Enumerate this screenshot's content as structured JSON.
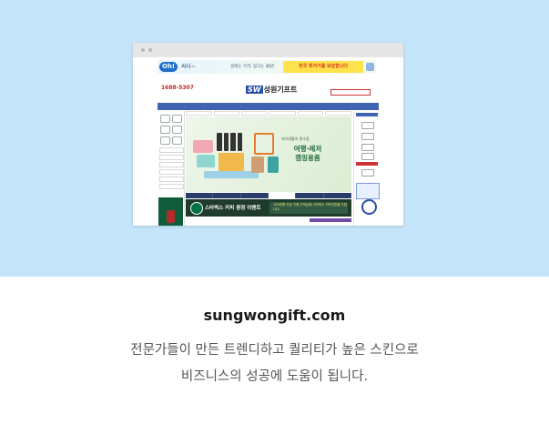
{
  "site_url": "sungwongift.com",
  "description_lines": [
    "전문가들이 만든 트렌디하고 퀄리티가 높은 스킨으로",
    "비즈니스의 성공에 도움이 됩니다."
  ],
  "preview": {
    "top_banner": {
      "badge": "Oh!",
      "headline": "싸다~",
      "middle": "설레는 가격, 믿고는 몰랄!",
      "right": "전국 최저가를 보장합니다"
    },
    "header": {
      "phone": "1688-5307",
      "logo_mark": "SW",
      "logo_text": "성원기프트"
    },
    "nav_items": [
      "",
      "",
      "",
      "",
      "",
      "",
      "",
      "",
      "",
      "",
      "",
      ""
    ],
    "banner": {
      "subtitle": "여아생활의 필수품",
      "title_line1": "여행·레저",
      "title_line2": "캠핑용품"
    },
    "promo": {
      "title": "스타벅스 커피 증정 이벤트",
      "right_line1": "100만원 이상 구매 고객님께 스타벅스 기프티콘을 드립니다."
    }
  },
  "colors": {
    "hero_bg": "#c4e4fa",
    "nav": "#3f63b3",
    "promo": "#1f3b2c"
  }
}
